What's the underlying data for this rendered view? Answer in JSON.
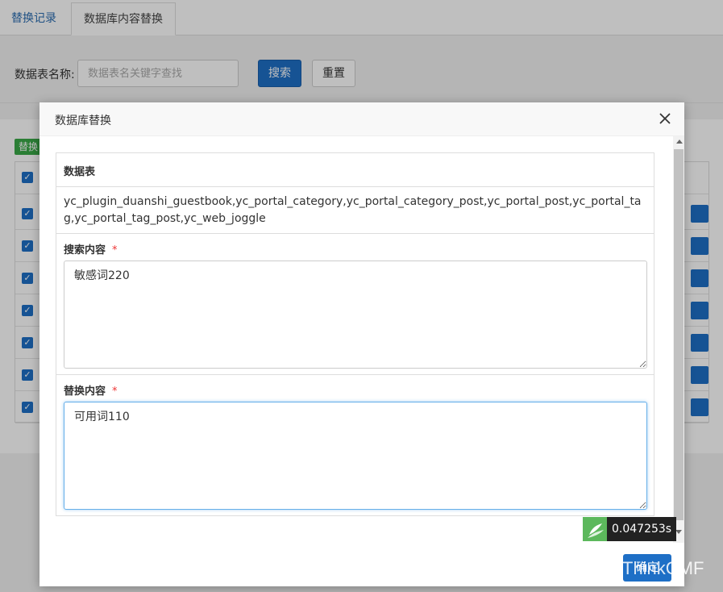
{
  "tabs": [
    {
      "label": "替换记录"
    },
    {
      "label": "数据库内容替换"
    }
  ],
  "search": {
    "label": "数据表名称:",
    "placeholder": "数据表名关键字查找",
    "search_button": "搜索",
    "reset_button": "重置"
  },
  "list": {
    "tag": "替换"
  },
  "modal": {
    "title": "数据库替换",
    "table_section": {
      "header": "数据表",
      "value": "yc_plugin_duanshi_guestbook,yc_portal_category,yc_portal_category_post,yc_portal_post,yc_portal_tag,yc_portal_tag_post,yc_web_joggle"
    },
    "search_field": {
      "label": "搜索内容",
      "required_mark": "*",
      "value": "敏感词220"
    },
    "replace_field": {
      "label": "替换内容",
      "required_mark": "*",
      "value": "可用词110"
    },
    "confirm_button": "确定"
  },
  "trace": {
    "time": "0.047253s"
  },
  "watermark": "ThinkCMF",
  "colors": {
    "primary": "#1e6fc6",
    "green": "#3aa847"
  }
}
